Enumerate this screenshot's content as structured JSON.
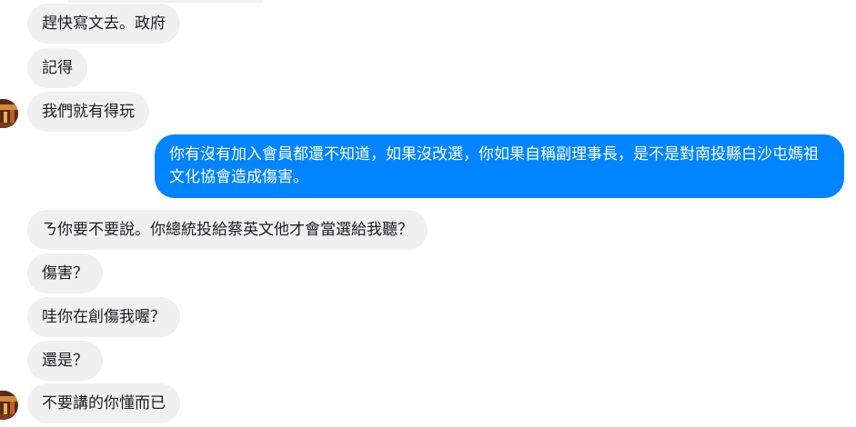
{
  "thread": {
    "messages": [
      {
        "sender": "other",
        "text": "趕快寫文去。政府"
      },
      {
        "sender": "other",
        "text": "記得"
      },
      {
        "sender": "other",
        "text": "我們就有得玩"
      },
      {
        "sender": "self",
        "text": "你有沒有加入會員都還不知道，如果沒改選，你如果自稱副理事長，是不是對南投縣白沙屯媽祖文化協會造成傷害。"
      },
      {
        "sender": "other",
        "text": "ㄋ你要不要說。你總統投給蔡英文他才會當選給我聽？"
      },
      {
        "sender": "other",
        "text": "傷害？"
      },
      {
        "sender": "other",
        "text": "哇你在創傷我喔？"
      },
      {
        "sender": "other",
        "text": "還是？"
      },
      {
        "sender": "other",
        "text": "不要講的你懂而已"
      }
    ]
  },
  "colors": {
    "incoming_bubble": "#f1f0f0",
    "outgoing_bubble": "#0084ff",
    "incoming_text": "#1c1e21",
    "outgoing_text": "#ffffff"
  }
}
